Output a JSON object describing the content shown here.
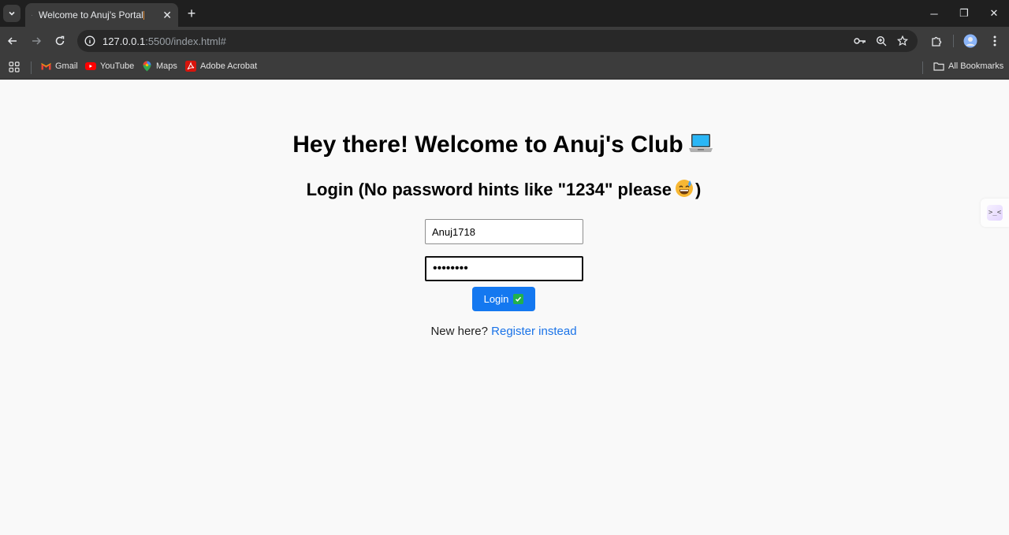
{
  "browser": {
    "tab": {
      "title": "Welcome to Anuj's Portal",
      "close": "✕"
    },
    "newtab": "+",
    "window": {
      "minimize": "─",
      "restore": "❐",
      "close": "✕"
    },
    "url": {
      "host": "127.0.0.1",
      "rest": ":5500/index.html#"
    },
    "bookmarks": [
      {
        "label": "Gmail",
        "icon": "gmail-icon"
      },
      {
        "label": "YouTube",
        "icon": "youtube-icon"
      },
      {
        "label": "Maps",
        "icon": "maps-icon"
      },
      {
        "label": "Adobe Acrobat",
        "icon": "adobe-acrobat-icon"
      }
    ],
    "all_bookmarks": "All Bookmarks"
  },
  "page": {
    "title": "Hey there! Welcome to Anuj's Club",
    "subtitle_open": "Login (No password hints like \"1234\" please",
    "subtitle_close": ")",
    "username_value": "Anuj1718",
    "password_value": "xxxxxxxx",
    "login_button": "Login",
    "register_prompt": "New here?",
    "register_link": "Register instead"
  },
  "colors": {
    "accent": "#1478f0",
    "link": "#1a73e8",
    "check": "#22b14c"
  }
}
